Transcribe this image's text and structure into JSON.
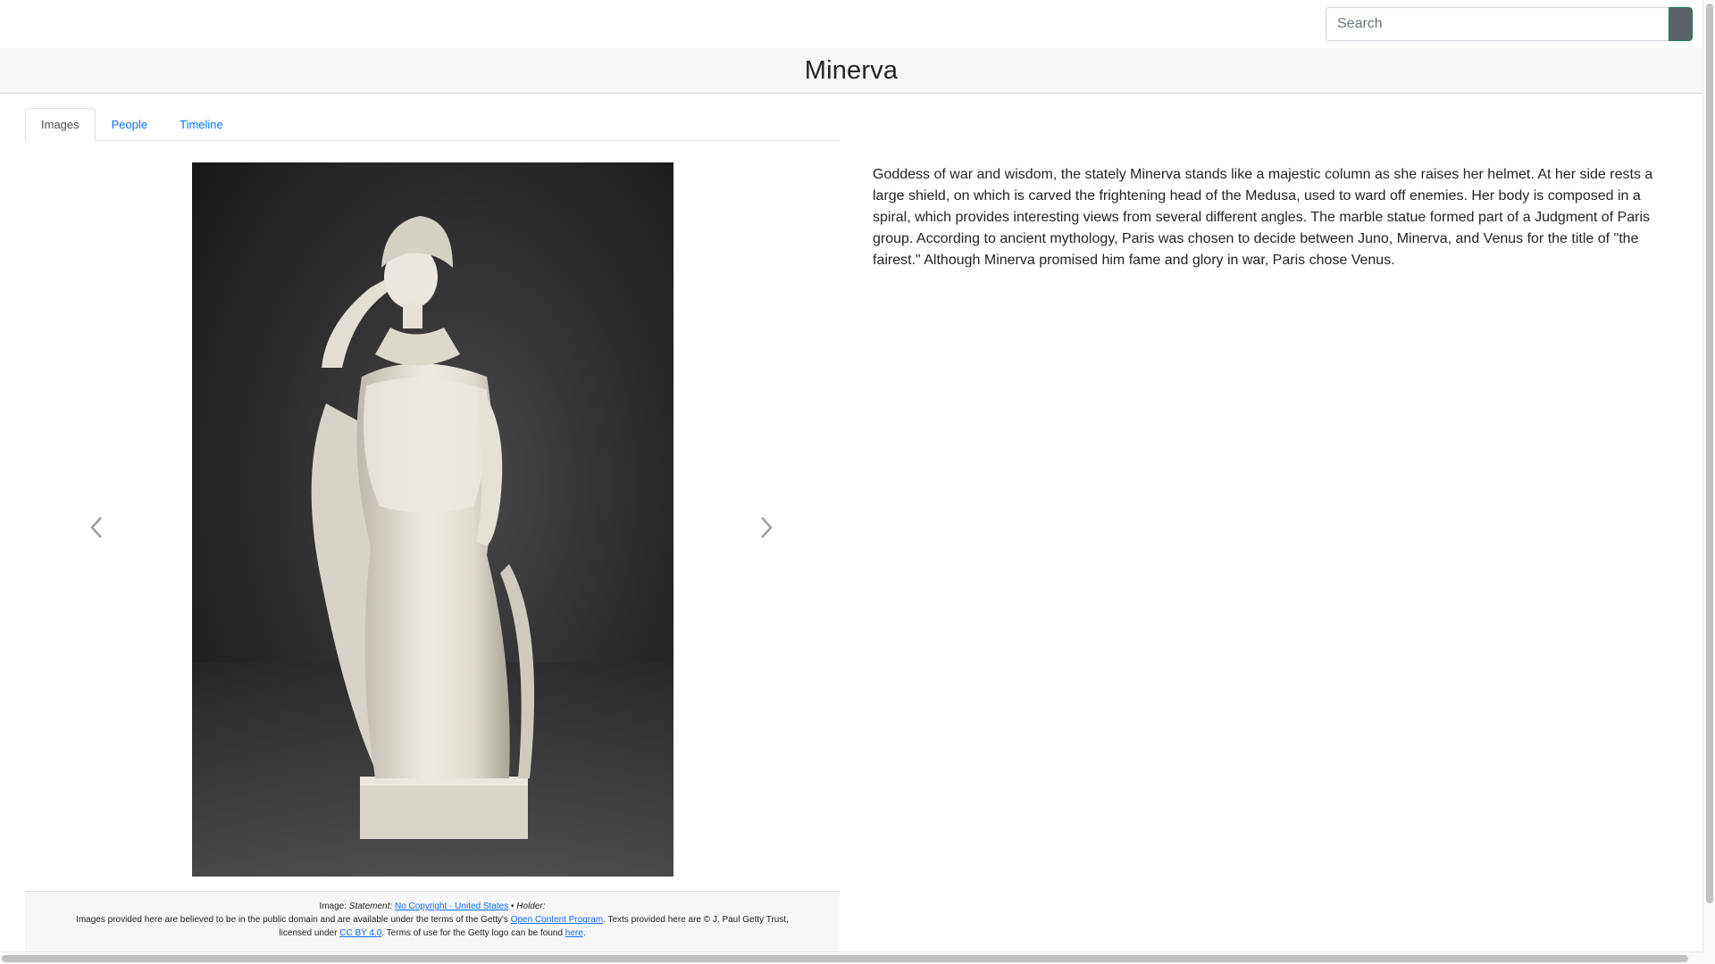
{
  "search": {
    "placeholder": "Search",
    "value": ""
  },
  "header": {
    "title": "Minerva"
  },
  "tabs": [
    {
      "label": "Images",
      "active": true
    },
    {
      "label": "People",
      "active": false
    },
    {
      "label": "Timeline",
      "active": false
    }
  ],
  "carousel": {
    "image_alt": "Marble statue of Minerva",
    "prev_icon": "chevron-left-icon",
    "next_icon": "chevron-right-icon"
  },
  "footer": {
    "image_label": "Image:",
    "statement_label": "Statement:",
    "statement_link": "No Copyright - United States",
    "separator": "•",
    "holder_label": "Holder:",
    "line2_prefix": "Images provided here are believed to be in the public domain and are available under the terms of the Getty's",
    "open_content_link": "Open Content Program",
    "line2_suffix": ". Texts provided here are © J. Paul Getty Trust,",
    "line3_prefix": "licensed under",
    "license_link": "CC BY 4.0",
    "line3_middle": ". Terms of use for the Getty logo can be found",
    "here_link": "here",
    "line3_suffix": "."
  },
  "description": "Goddess of war and wisdom, the stately Minerva stands like a majestic column as she raises her helmet. At her side rests a large shield, on which is carved the frightening head of the Medusa, used to ward off enemies. Her body is composed in a spiral, which provides interesting views from several different angles. The marble statue formed part of a Judgment of Paris group. According to ancient mythology, Paris was chosen to decide between Juno, Minerva, and Venus for the title of \"the fairest.\" Although Minerva promised him fame and glory in war, Paris chose Venus.",
  "colors": {
    "link": "#0d6efd",
    "search_button": "#5a6468",
    "title_bar": "#f6f6f6"
  }
}
